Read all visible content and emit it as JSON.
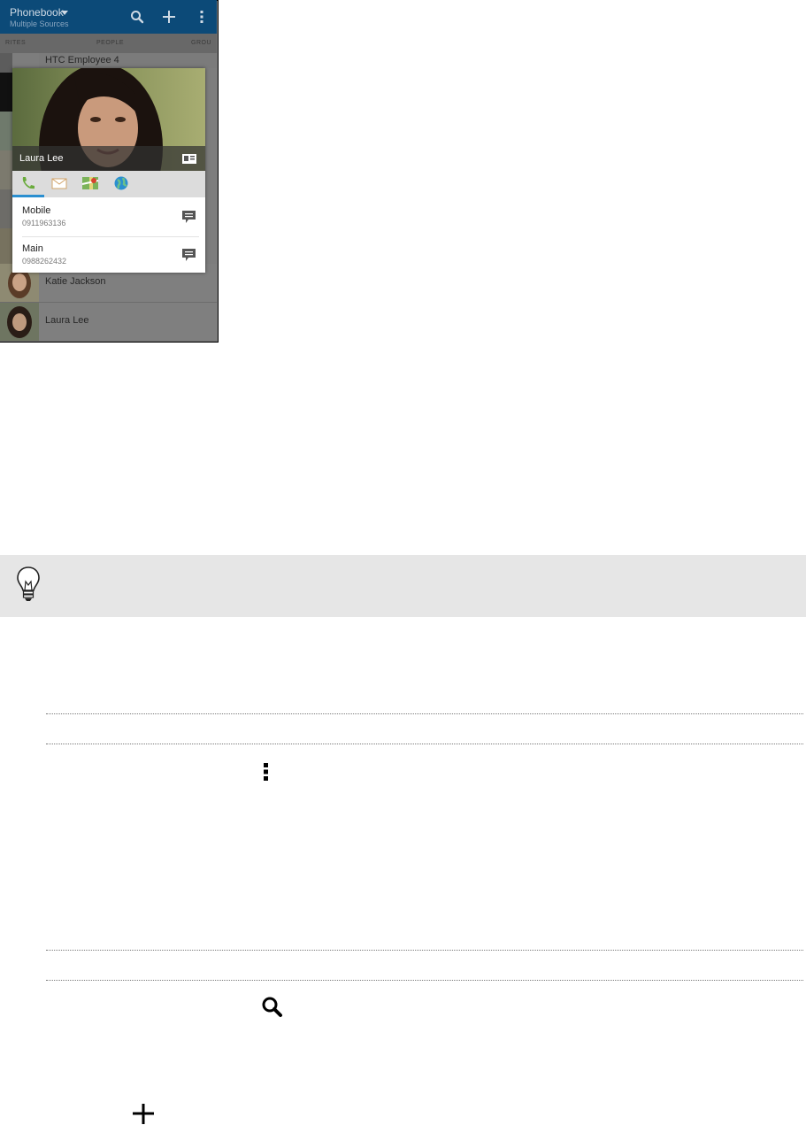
{
  "phone": {
    "app_title": "Phonebook",
    "app_subtitle": "Multiple Sources",
    "tabs": [
      "RITES",
      "PEOPLE",
      "GROU"
    ],
    "behind_entry": "HTC Employee 4",
    "list": [
      {
        "name": "Katie Jackson"
      },
      {
        "name": "Laura Lee"
      }
    ],
    "icons": {
      "search": "search-icon",
      "add": "plus-icon",
      "menu": "overflow-menu-icon",
      "dropdown": "triangle-down-icon"
    }
  },
  "card": {
    "contact_name": "Laura Lee",
    "tabs": [
      "phone-icon",
      "mail-icon",
      "map-icon",
      "web-icon"
    ],
    "entries": [
      {
        "label": "Mobile",
        "number": "0911963136"
      },
      {
        "label": "Main",
        "number": "0988262432"
      }
    ],
    "accent_color": "#2b8fd0"
  },
  "doc_icons": {
    "tip": "lightbulb-icon",
    "menu": "overflow-menu-icon",
    "search": "search-icon",
    "add": "plus-icon"
  }
}
